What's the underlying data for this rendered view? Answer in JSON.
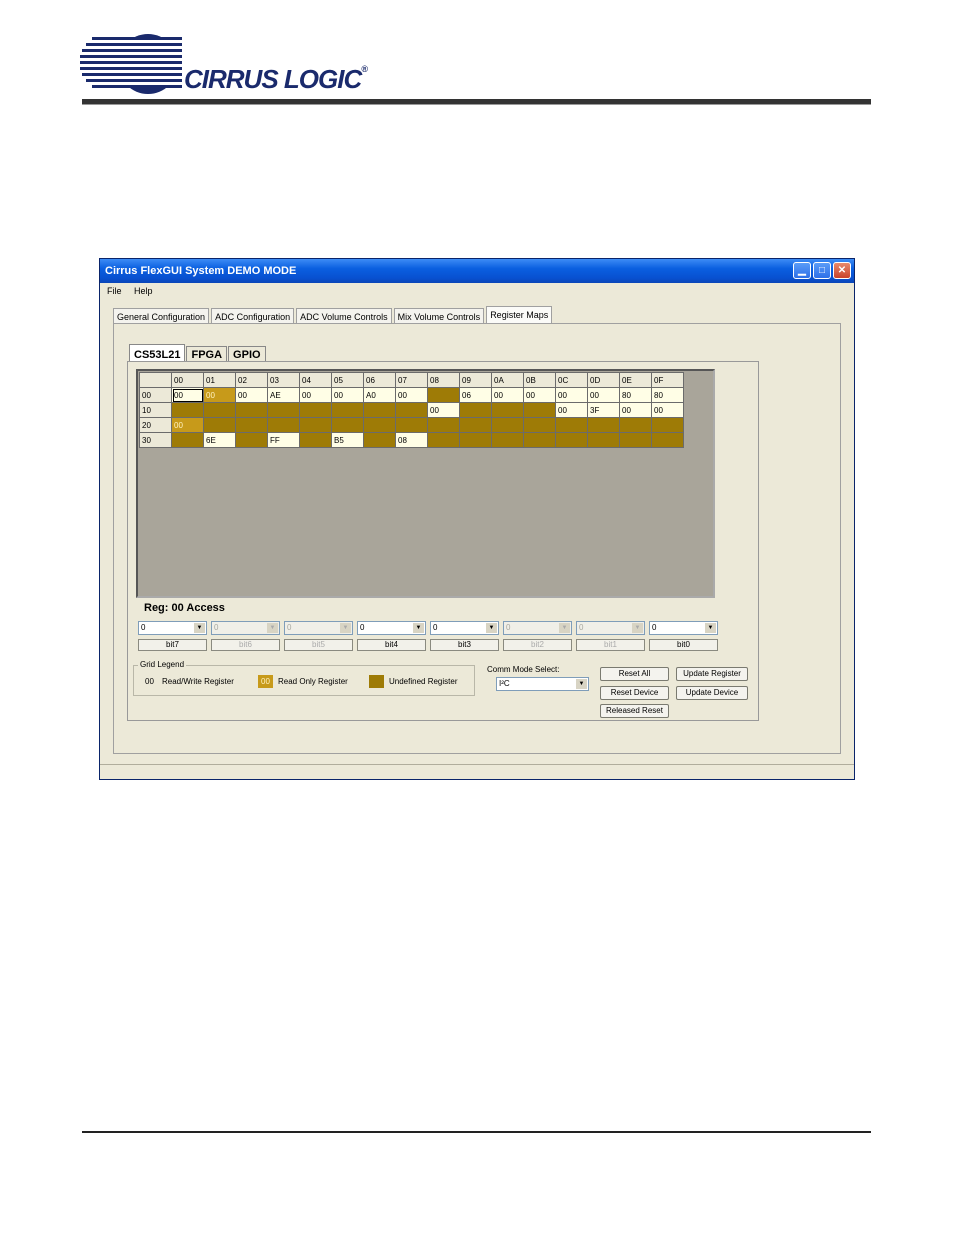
{
  "header": {
    "logo_text": "CIRRUS LOGIC",
    "logo_mark": "®"
  },
  "window": {
    "title": "Cirrus FlexGUI System DEMO MODE",
    "menu": [
      "File",
      "Help"
    ],
    "tabs": [
      "General Configuration",
      "ADC Configuration",
      "ADC Volume Controls",
      "Mix Volume Controls",
      "Register Maps"
    ],
    "active_tab": "Register Maps"
  },
  "sub_tabs": [
    "CS53L21",
    "FPGA",
    "GPIO"
  ],
  "grid": {
    "columns": [
      "00",
      "01",
      "02",
      "03",
      "04",
      "05",
      "06",
      "07",
      "08",
      "09",
      "0A",
      "0B",
      "0C",
      "0D",
      "0E",
      "0F"
    ],
    "rows": [
      {
        "label": "00",
        "cells": [
          {
            "v": "00",
            "t": "rw",
            "sel": true
          },
          {
            "v": "00",
            "t": "ro"
          },
          {
            "v": "00",
            "t": "rw"
          },
          {
            "v": "AE",
            "t": "rw"
          },
          {
            "v": "00",
            "t": "rw"
          },
          {
            "v": "00",
            "t": "rw"
          },
          {
            "v": "A0",
            "t": "rw"
          },
          {
            "v": "00",
            "t": "rw"
          },
          {
            "v": "",
            "t": "und"
          },
          {
            "v": "06",
            "t": "rw"
          },
          {
            "v": "00",
            "t": "rw"
          },
          {
            "v": "00",
            "t": "rw"
          },
          {
            "v": "00",
            "t": "rw"
          },
          {
            "v": "00",
            "t": "rw"
          },
          {
            "v": "80",
            "t": "rw"
          },
          {
            "v": "80",
            "t": "rw"
          }
        ]
      },
      {
        "label": "10",
        "cells": [
          {
            "v": "",
            "t": "und"
          },
          {
            "v": "",
            "t": "und"
          },
          {
            "v": "",
            "t": "und"
          },
          {
            "v": "",
            "t": "und"
          },
          {
            "v": "",
            "t": "und"
          },
          {
            "v": "",
            "t": "und"
          },
          {
            "v": "",
            "t": "und"
          },
          {
            "v": "",
            "t": "und"
          },
          {
            "v": "00",
            "t": "rw"
          },
          {
            "v": "",
            "t": "und"
          },
          {
            "v": "",
            "t": "und"
          },
          {
            "v": "",
            "t": "und"
          },
          {
            "v": "00",
            "t": "rw"
          },
          {
            "v": "3F",
            "t": "rw"
          },
          {
            "v": "00",
            "t": "rw"
          },
          {
            "v": "00",
            "t": "rw"
          }
        ]
      },
      {
        "label": "20",
        "cells": [
          {
            "v": "00",
            "t": "ro"
          },
          {
            "v": "",
            "t": "und"
          },
          {
            "v": "",
            "t": "und"
          },
          {
            "v": "",
            "t": "und"
          },
          {
            "v": "",
            "t": "und"
          },
          {
            "v": "",
            "t": "und"
          },
          {
            "v": "",
            "t": "und"
          },
          {
            "v": "",
            "t": "und"
          },
          {
            "v": "",
            "t": "und"
          },
          {
            "v": "",
            "t": "und"
          },
          {
            "v": "",
            "t": "und"
          },
          {
            "v": "",
            "t": "und"
          },
          {
            "v": "",
            "t": "und"
          },
          {
            "v": "",
            "t": "und"
          },
          {
            "v": "",
            "t": "und"
          },
          {
            "v": "",
            "t": "und"
          }
        ]
      },
      {
        "label": "30",
        "cells": [
          {
            "v": "",
            "t": "und"
          },
          {
            "v": "6E",
            "t": "rw"
          },
          {
            "v": "",
            "t": "und"
          },
          {
            "v": "FF",
            "t": "rw"
          },
          {
            "v": "",
            "t": "und"
          },
          {
            "v": "B5",
            "t": "rw"
          },
          {
            "v": "",
            "t": "und"
          },
          {
            "v": "08",
            "t": "rw"
          },
          {
            "v": "",
            "t": "und"
          },
          {
            "v": "",
            "t": "und"
          },
          {
            "v": "",
            "t": "und"
          },
          {
            "v": "",
            "t": "und"
          },
          {
            "v": "",
            "t": "und"
          },
          {
            "v": "",
            "t": "und"
          },
          {
            "v": "",
            "t": "und"
          },
          {
            "v": "",
            "t": "und"
          }
        ]
      }
    ]
  },
  "access": {
    "title": "Reg: 00 Access",
    "bits": [
      {
        "label": "bit7",
        "value": "0",
        "enabled": true
      },
      {
        "label": "bit6",
        "value": "0",
        "enabled": false
      },
      {
        "label": "bit5",
        "value": "0",
        "enabled": false
      },
      {
        "label": "bit4",
        "value": "0",
        "enabled": true
      },
      {
        "label": "bit3",
        "value": "0",
        "enabled": true
      },
      {
        "label": "bit2",
        "value": "0",
        "enabled": false
      },
      {
        "label": "bit1",
        "value": "0",
        "enabled": false
      },
      {
        "label": "bit0",
        "value": "0",
        "enabled": true
      }
    ]
  },
  "legend": {
    "title": "Grid Legend",
    "rw_sample": "00",
    "rw_label": "Read/Write Register",
    "ro_sample": "00",
    "ro_label": "Read Only Register",
    "und_label": "Undefined Register"
  },
  "comm": {
    "label": "Comm Mode Select:",
    "value": "I²C"
  },
  "buttons": {
    "reset_all": "Reset All",
    "update_register": "Update Register",
    "reset_device": "Reset Device",
    "update_device": "Update Device",
    "released_reset": "Released Reset"
  },
  "colors": {
    "read_write": "#fffee6",
    "read_only": "#c79a1a",
    "undefined": "#9e7b06",
    "titlebar": "#0a5fe0"
  }
}
